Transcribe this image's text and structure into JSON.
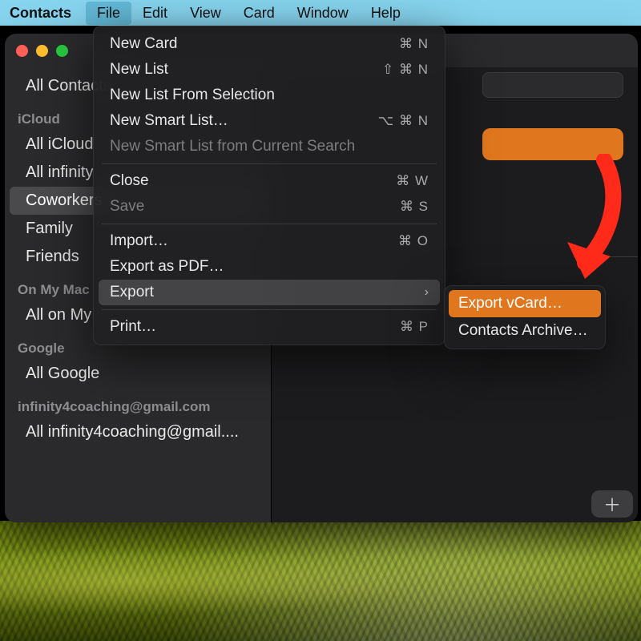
{
  "menubar": {
    "app": "Contacts",
    "items": [
      "File",
      "Edit",
      "View",
      "Card",
      "Window",
      "Help"
    ],
    "active_index": 0
  },
  "sidebar": {
    "top_item": "All Contacts",
    "groups": [
      {
        "title": "iCloud",
        "items": [
          "All iCloud",
          "All infinity",
          "Coworkers",
          "Family",
          "Friends"
        ],
        "selected_index": 2
      },
      {
        "title": "On My Mac",
        "items": [
          "All on My"
        ]
      },
      {
        "title": "Google",
        "items": [
          "All Google"
        ]
      },
      {
        "title": "infinity4coaching@gmail.com",
        "items": [
          "All infinity4coaching@gmail...."
        ]
      }
    ]
  },
  "file_menu": {
    "items": [
      {
        "label": "New Card",
        "shortcut": "⌘ N"
      },
      {
        "label": "New List",
        "shortcut": "⇧ ⌘ N"
      },
      {
        "label": "New List From Selection"
      },
      {
        "label": "New Smart List…",
        "shortcut": "⌥ ⌘ N"
      },
      {
        "label": "New Smart List from Current Search",
        "disabled": true
      },
      {
        "sep": true
      },
      {
        "label": "Close",
        "shortcut": "⌘ W"
      },
      {
        "label": "Save",
        "shortcut": "⌘ S",
        "disabled": true
      },
      {
        "sep": true
      },
      {
        "label": "Import…",
        "shortcut": "⌘ O"
      },
      {
        "label": "Export as PDF…"
      },
      {
        "label": "Export",
        "submenu": true,
        "hover": true
      },
      {
        "sep": true
      },
      {
        "label": "Print…",
        "shortcut": "⌘ P"
      }
    ]
  },
  "export_submenu": {
    "items": [
      {
        "label": "Export vCard…",
        "highlight": true
      },
      {
        "label": "Contacts Archive…"
      }
    ]
  },
  "add_button_glyph": "＋"
}
